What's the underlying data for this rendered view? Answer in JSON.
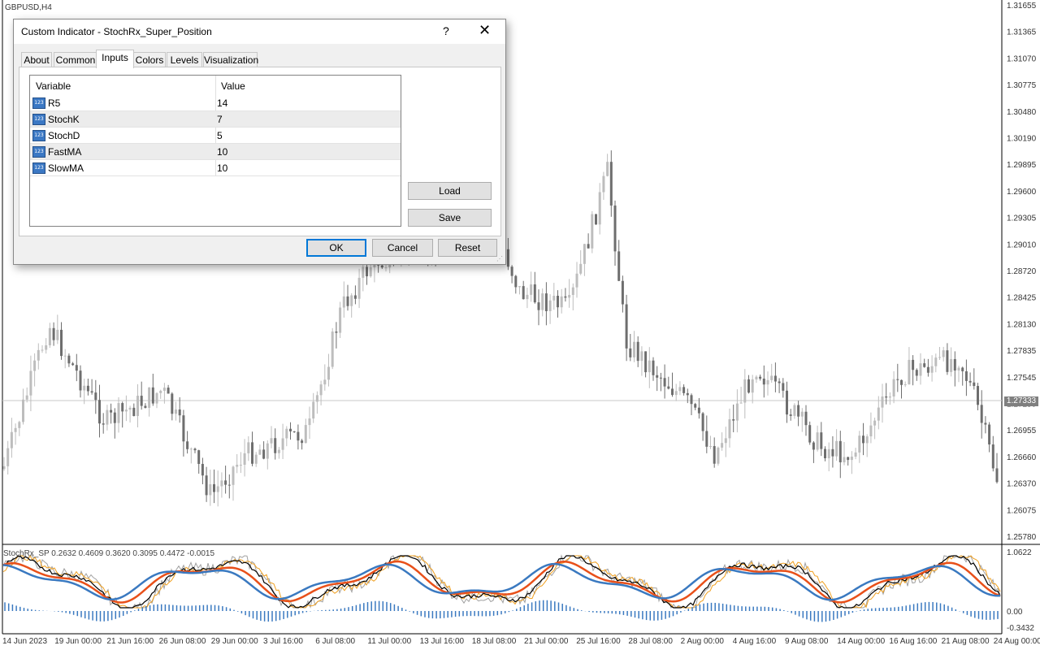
{
  "window": {
    "symbol_label": "GBPUSD,H4"
  },
  "price_axis": {
    "labels": [
      "1.31655",
      "1.31365",
      "1.31070",
      "1.30775",
      "1.30480",
      "1.30190",
      "1.29895",
      "1.29600",
      "1.29305",
      "1.29010",
      "1.28720",
      "1.28425",
      "1.28130",
      "1.27835",
      "1.27545",
      "1.27250",
      "1.26955",
      "1.26660",
      "1.26370",
      "1.26075",
      "1.25780"
    ],
    "current_price": "1.27333"
  },
  "indicator_axis": {
    "labels": [
      "1.0622",
      "0.00",
      "-0.3432"
    ]
  },
  "indicator_caption": "StochRx_SP 0.2632 0.4609 0.3620 0.3095 0.4472 -0.0015",
  "time_axis": {
    "labels": [
      "14 Jun 2023",
      "19 Jun 00:00",
      "21 Jun 16:00",
      "26 Jun 08:00",
      "29 Jun 00:00",
      "3 Jul 16:00",
      "6 Jul 08:00",
      "11 Jul 00:00",
      "13 Jul 16:00",
      "18 Jul 08:00",
      "21 Jul 00:00",
      "25 Jul 16:00",
      "28 Jul 08:00",
      "2 Aug 00:00",
      "4 Aug 16:00",
      "9 Aug 08:00",
      "14 Aug 00:00",
      "16 Aug 16:00",
      "21 Aug 08:00",
      "24 Aug 00:00"
    ]
  },
  "colors": {
    "candle_up": "#bdbdbd",
    "candle_down": "#6e6e6e",
    "stoch_main": "#000000",
    "stoch_raw": "#a0a0a0",
    "stoch_signal": "#f0a020",
    "fast_ma": "#e8501a",
    "slow_ma": "#3a79c0",
    "histogram": "#3a79c0",
    "dialog_accent": "#0078d7"
  },
  "dialog": {
    "title": "Custom Indicator - StochRx_Super_Position",
    "help_glyph": "?",
    "close_glyph": "✕",
    "tabs": [
      {
        "label": "About"
      },
      {
        "label": "Common"
      },
      {
        "label": "Inputs",
        "active": true
      },
      {
        "label": "Colors"
      },
      {
        "label": "Levels"
      },
      {
        "label": "Visualization"
      }
    ],
    "grid": {
      "header_variable": "Variable",
      "header_value": "Value",
      "type_icon": "123",
      "rows": [
        {
          "variable": "R5",
          "value": "14"
        },
        {
          "variable": "StochK",
          "value": "7"
        },
        {
          "variable": "StochD",
          "value": "5"
        },
        {
          "variable": "FastMA",
          "value": "10"
        },
        {
          "variable": "SlowMA",
          "value": "10"
        }
      ]
    },
    "load_label": "Load",
    "save_label": "Save",
    "ok_label": "OK",
    "cancel_label": "Cancel",
    "reset_label": "Reset"
  }
}
